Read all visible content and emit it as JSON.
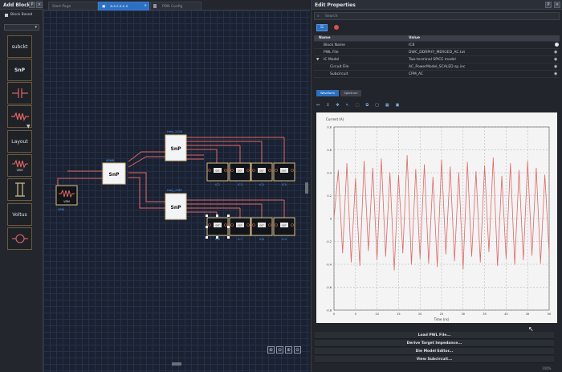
{
  "left_panel": {
    "title": "Add Block",
    "block_based_label": "Block Based",
    "items": [
      {
        "label": "subckt"
      },
      {
        "label": "SnP"
      },
      {
        "label": ""
      },
      {
        "label": ""
      },
      {
        "label": "Layout"
      },
      {
        "label": "VRM"
      },
      {
        "label": ""
      },
      {
        "label": "Voltus"
      },
      {
        "label": ""
      }
    ]
  },
  "tabs": [
    {
      "label": "Start Page"
    },
    {
      "label": "a.s.c.s.c.s"
    },
    {
      "label": "PDN Config"
    }
  ],
  "schematic": {
    "vrm_label": "VRM",
    "vrm_caption": "VRM",
    "snp1_label": "SnP",
    "snp1_caption": "VPWR",
    "snp2_label": "SnP",
    "snp2_caption": "Hdry_2145",
    "snp3_label": "SnP",
    "snp3_caption": "Hdry_2387",
    "ic_top": [
      "IC2",
      "IC3",
      "IC4",
      "IC5"
    ],
    "ic_bottom": [
      "IC6",
      "IC7",
      "IC8",
      "IC9"
    ],
    "ic_box_label": "OUT"
  },
  "right_panel": {
    "title": "Edit Properties",
    "search_placeholder": "Search",
    "columns": {
      "name": "Name",
      "value": "Value"
    },
    "rows": [
      {
        "name": "Block Name",
        "value": "IC8"
      },
      {
        "name": "PWL File",
        "value": "DWC_DDRPHY_MERGED_AC.txt"
      },
      {
        "name": "IC Model",
        "value": "Two-terminal SPICE model"
      },
      {
        "name": "Circuit File",
        "value": "AC_PowerModel_SCALED.sp.inc"
      },
      {
        "name": "Subcircuit",
        "value": "CPM_AC"
      }
    ],
    "plot_tabs": [
      "Waveform",
      "Spectrum"
    ],
    "buttons": [
      "Load PWL File...",
      "Derive Target Impedance...",
      "Die Model Editor...",
      "View Subcircuit..."
    ],
    "zoom": "100%"
  },
  "chart_data": {
    "type": "line",
    "title": "",
    "ylabel": "Current (A)",
    "xlabel": "Time (ns)",
    "xlim": [
      0,
      50
    ],
    "ylim": [
      -0.8,
      0.8
    ],
    "x_ticks": [
      "0",
      "5",
      "10",
      "15",
      "20",
      "25",
      "30",
      "35",
      "40",
      "45",
      "50"
    ],
    "y_ticks": [
      "-0.8",
      "-0.6",
      "-0.4",
      "-0.2",
      "0",
      "0.2",
      "0.4",
      "0.6",
      "0.8"
    ],
    "grid": true,
    "series": [
      {
        "color": "#e06666",
        "x": [
          0,
          1,
          2,
          3,
          4,
          5,
          6,
          7,
          8,
          9,
          10,
          11,
          12,
          13,
          14,
          15,
          16,
          17,
          18,
          19,
          20,
          21,
          22,
          23,
          24,
          25,
          26,
          27,
          28,
          29,
          30,
          31,
          32,
          33,
          34,
          35,
          36,
          37,
          38,
          39,
          40,
          41,
          42,
          43,
          44,
          45,
          46,
          47,
          48,
          49,
          50
        ],
        "y": [
          0,
          0.42,
          -0.3,
          0.48,
          -0.38,
          0.35,
          -0.41,
          0.5,
          -0.28,
          0.44,
          -0.36,
          0.52,
          -0.33,
          0.4,
          -0.45,
          0.38,
          -0.3,
          0.55,
          -0.4,
          0.43,
          -0.35,
          0.47,
          -0.39,
          0.36,
          -0.42,
          0.51,
          -0.31,
          0.45,
          -0.37,
          0.4,
          -0.44,
          0.49,
          -0.33,
          0.41,
          -0.38,
          0.46,
          -0.29,
          0.53,
          -0.41,
          0.37,
          -0.35,
          0.48,
          -0.4,
          0.42,
          -0.36,
          0.5,
          -0.32,
          0.44,
          -0.39,
          0.38,
          -0.3
        ]
      }
    ]
  },
  "colors": {
    "accent": "#2d6fc2",
    "snp_fill": "#ffffff",
    "wire": "#e06666",
    "label_blue": "#4aa3ff",
    "ic_border": "#d9c08a"
  }
}
